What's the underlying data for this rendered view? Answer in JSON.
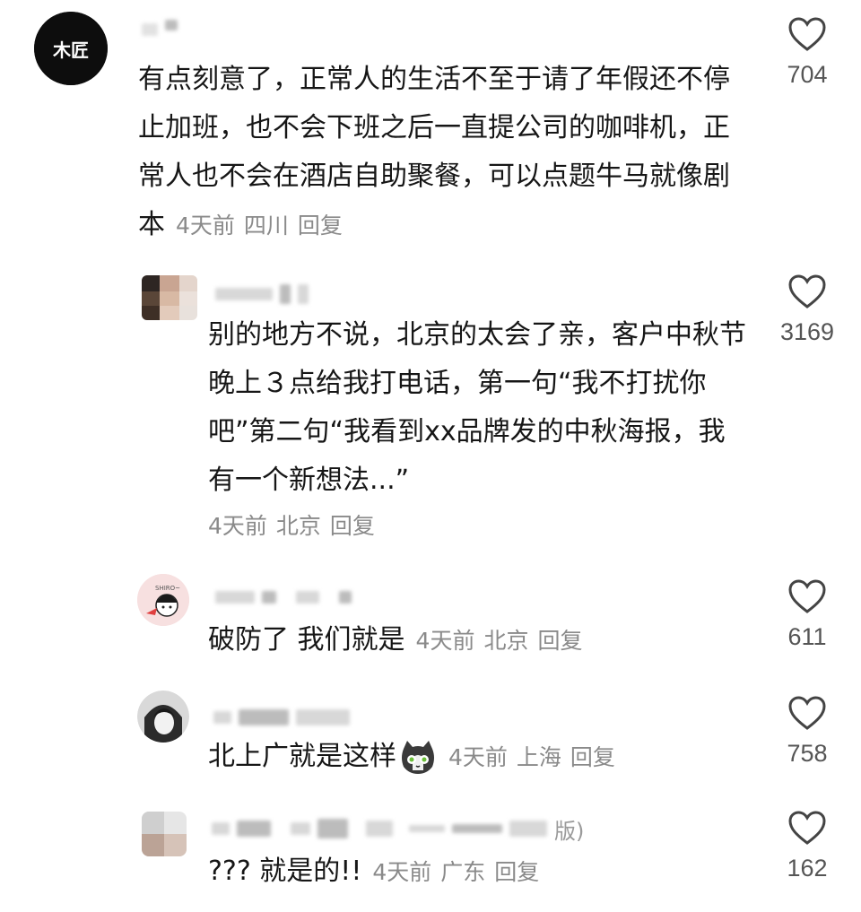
{
  "comments": [
    {
      "avatar_label": "木匠",
      "text": "有点刻意了，正常人的生活不至于请了年假还不停止加班，也不会下班之后一直提公司的咖啡机，正常人也不会在酒店自助聚餐，可以点题牛马就像剧本",
      "time": "4天前",
      "location": "四川",
      "reply": "回复",
      "likes": "704"
    },
    {
      "text": "别的地方不说，北京的太会了亲，客户中秋节晚上３点给我打电话，第一句“我不打扰你吧”第二句“我看到xx品牌发的中秋海报，我有一个新想法...”",
      "time": "4天前",
      "location": "北京",
      "reply": "回复",
      "likes": "3169"
    },
    {
      "avatar_label": "SHIRO~",
      "text": "破防了 我们就是",
      "time": "4天前",
      "location": "北京",
      "reply": "回复",
      "likes": "611"
    },
    {
      "text": "北上广就是这样",
      "time": "4天前",
      "location": "上海",
      "reply": "回复",
      "likes": "758"
    },
    {
      "text": "??? 就是的!!",
      "time": "4天前",
      "location": "广东",
      "reply": "回复",
      "likes": "162",
      "name_fragment": "版)"
    }
  ],
  "icons": {
    "like": "heart-outline-icon",
    "emoji": "cat-face-emoji-icon"
  },
  "colors": {
    "text": "#161616",
    "meta": "#8a8a8a",
    "count": "#555555"
  }
}
